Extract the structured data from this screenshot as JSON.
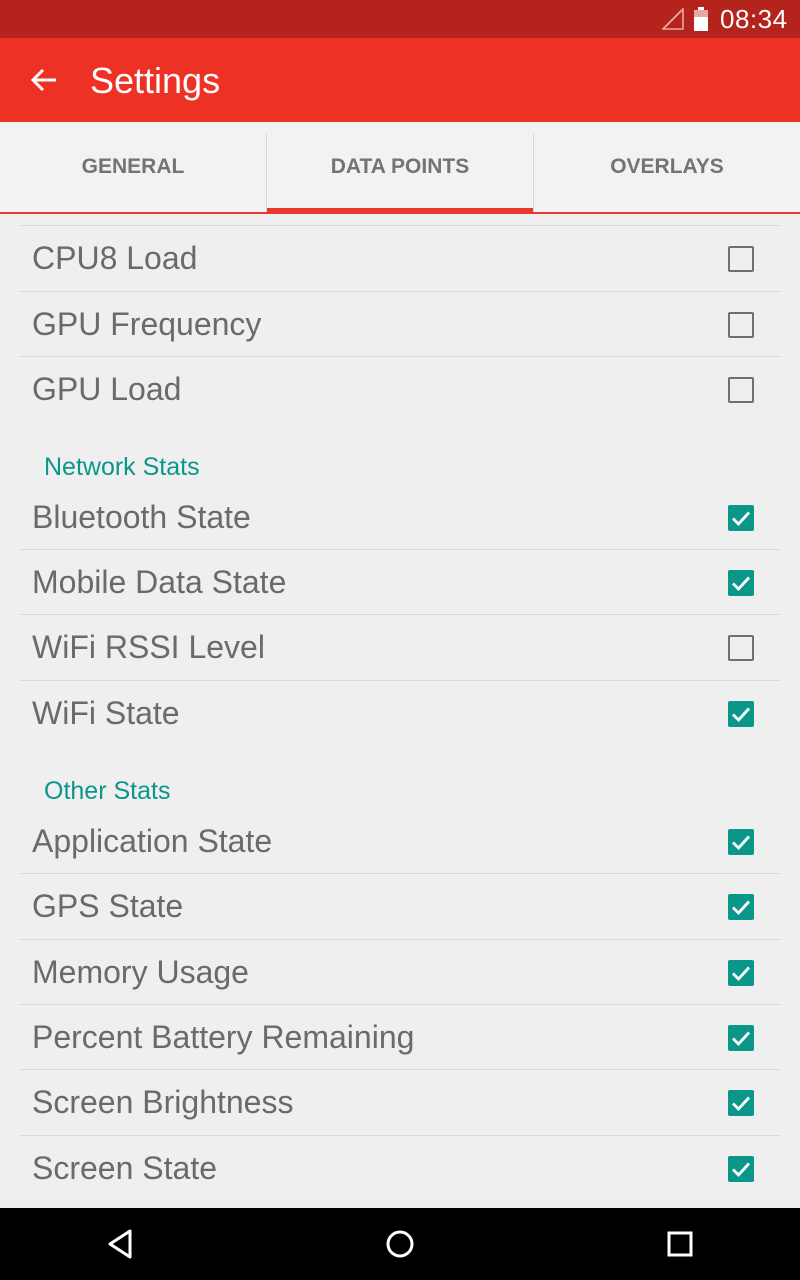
{
  "status_bar": {
    "time": "08:34",
    "icons": [
      "signal-icon",
      "battery-icon"
    ]
  },
  "toolbar": {
    "back_icon": "arrow-left-icon",
    "title": "Settings"
  },
  "tabs": [
    {
      "label": "GENERAL",
      "selected": false
    },
    {
      "label": "DATA POINTS",
      "selected": true
    },
    {
      "label": "OVERLAYS",
      "selected": false
    }
  ],
  "list": {
    "top_items": [
      {
        "label": "CPU8 Load",
        "checked": false
      },
      {
        "label": "GPU Frequency",
        "checked": false
      },
      {
        "label": "GPU Load",
        "checked": false
      }
    ],
    "network": {
      "header": "Network Stats",
      "items": [
        {
          "label": "Bluetooth State",
          "checked": true
        },
        {
          "label": "Mobile Data State",
          "checked": true
        },
        {
          "label": "WiFi RSSI Level",
          "checked": false
        },
        {
          "label": "WiFi State",
          "checked": true
        }
      ]
    },
    "other": {
      "header": "Other Stats",
      "items": [
        {
          "label": "Application State",
          "checked": true
        },
        {
          "label": "GPS State",
          "checked": true
        },
        {
          "label": "Memory Usage",
          "checked": true
        },
        {
          "label": "Percent Battery Remaining",
          "checked": true
        },
        {
          "label": "Screen Brightness",
          "checked": true
        },
        {
          "label": "Screen State",
          "checked": true
        }
      ]
    }
  },
  "nav_bar": {
    "icons": [
      "back-triangle-icon",
      "home-circle-icon",
      "recents-square-icon"
    ]
  },
  "colors": {
    "status_bar": "#b5241c",
    "toolbar": "#ee3125",
    "accent": "#0a978a",
    "tab_indicator": "#e8392d",
    "background": "#efeff0"
  }
}
